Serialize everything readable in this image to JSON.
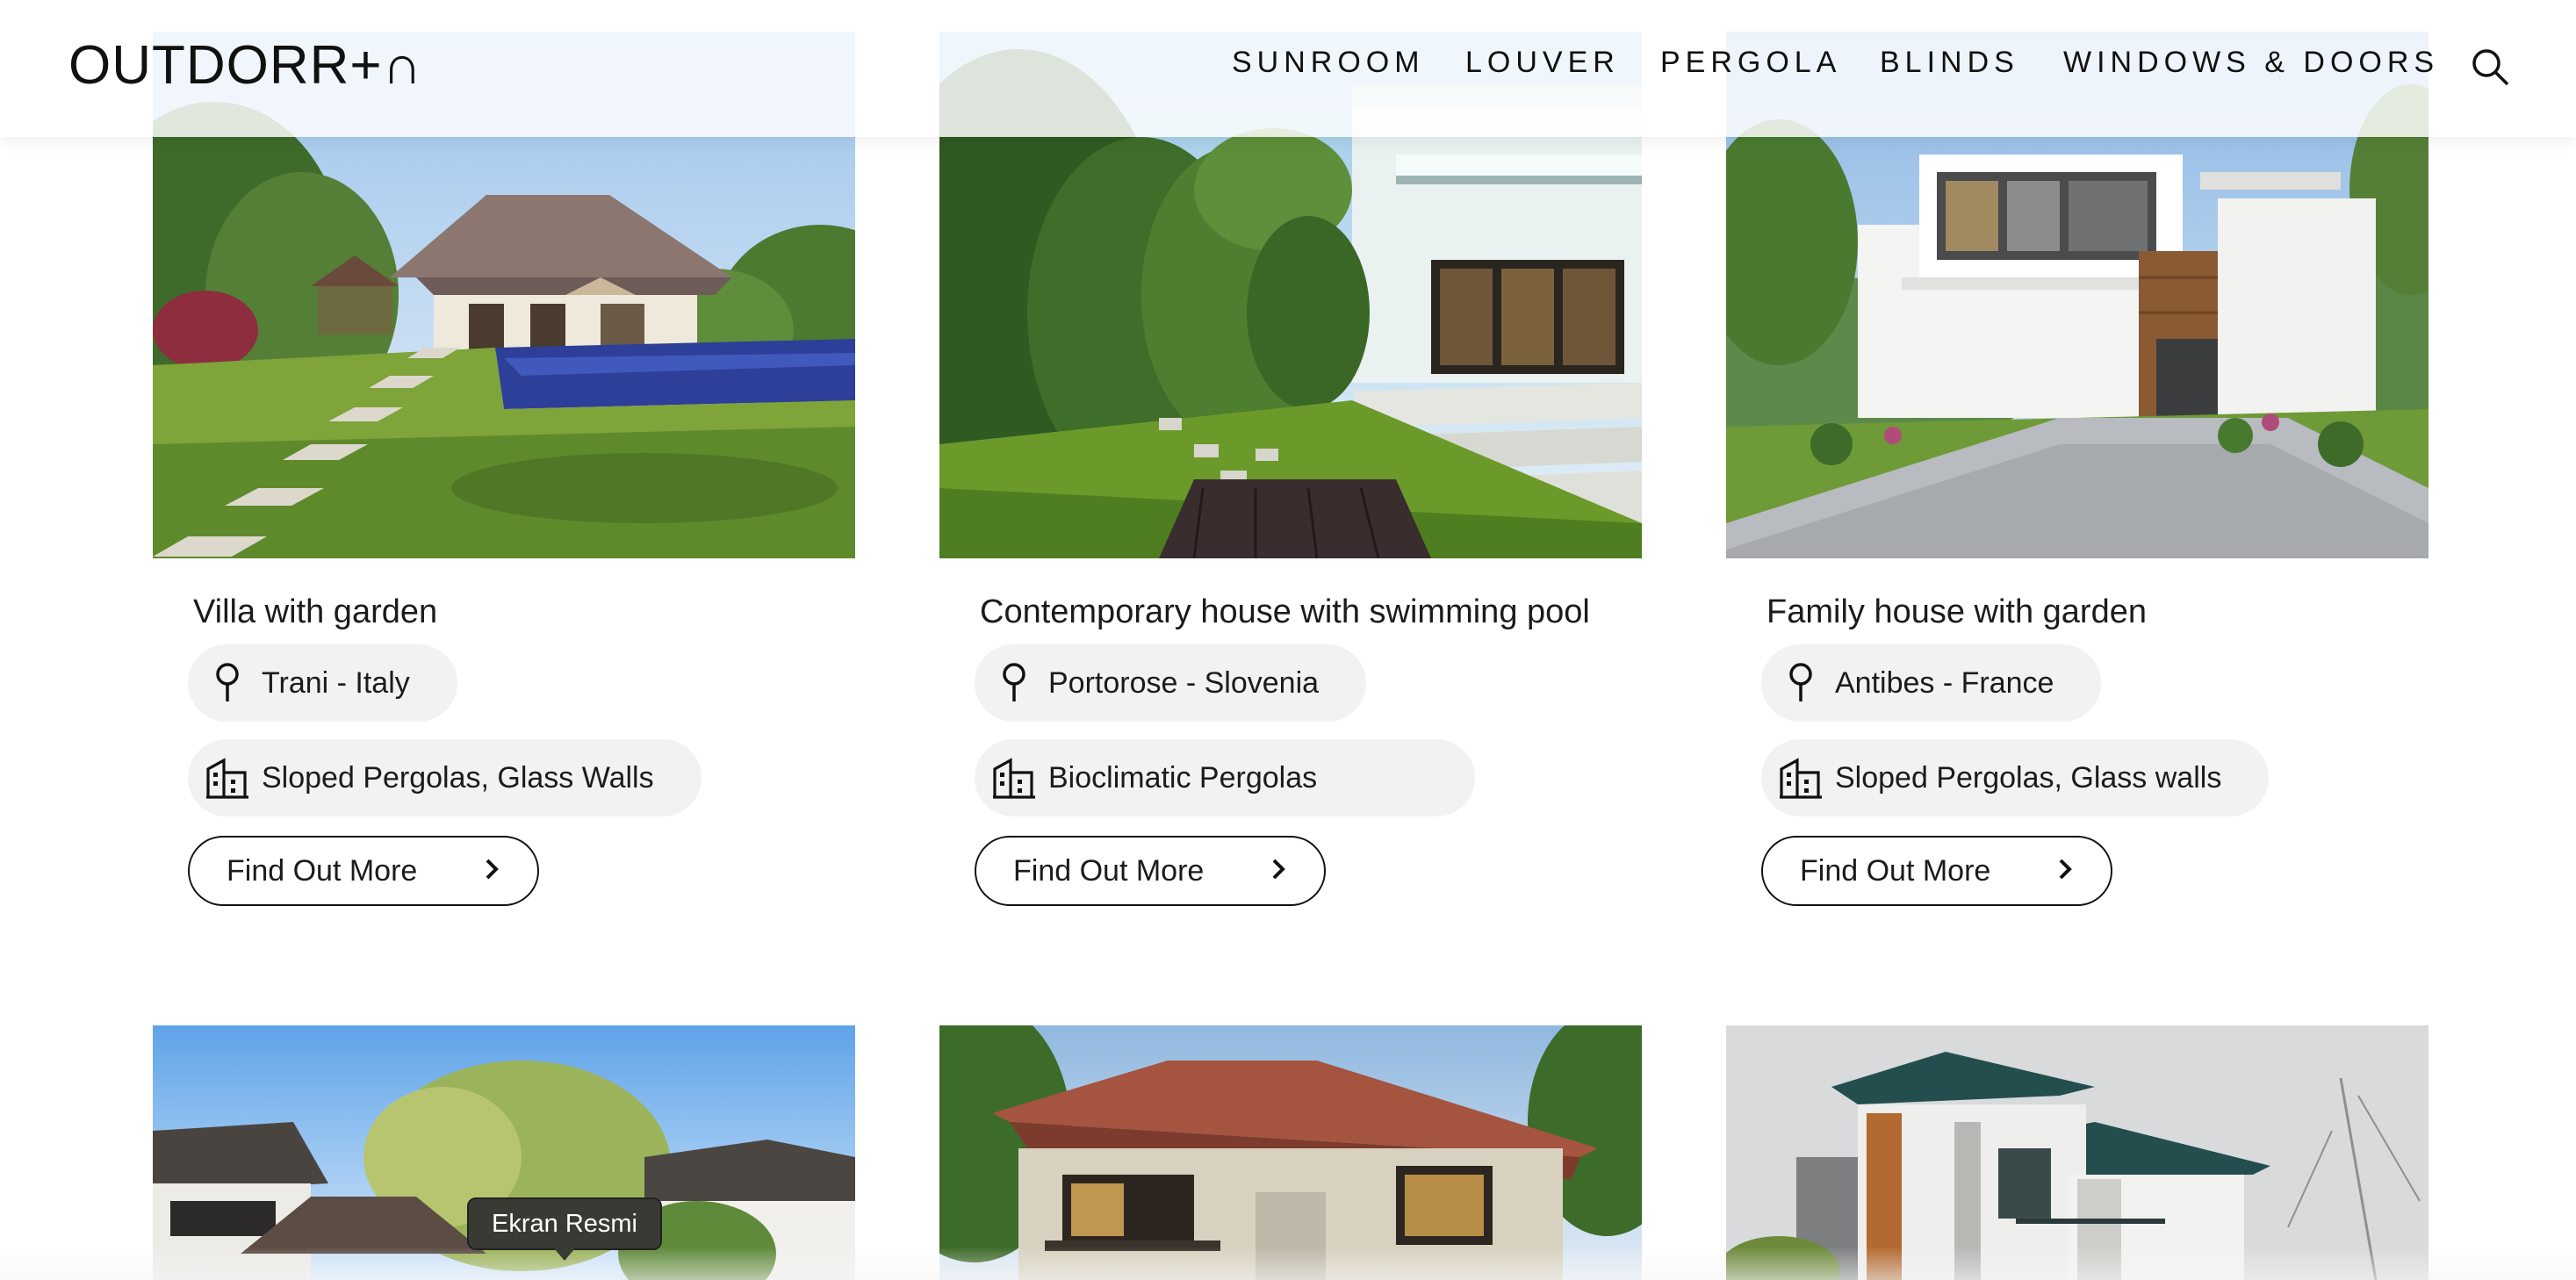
{
  "header": {
    "logo_text": "OUTDORR+∩",
    "nav": [
      {
        "label": "SUNROOM"
      },
      {
        "label": "LOUVER"
      },
      {
        "label": "PERGOLA"
      },
      {
        "label": "BLINDS"
      },
      {
        "label": "WINDOWS & DOORS"
      }
    ]
  },
  "projects": [
    {
      "title": "Villa with garden",
      "location": "Trani - Italy",
      "products": "Sloped Pergolas, Glass Walls",
      "button_label": "Find Out More",
      "image": "villa-pool-garden-photo"
    },
    {
      "title": "Contemporary house with swimming pool",
      "location": "Portorose - Slovenia",
      "products": "Bioclimatic Pergolas",
      "button_label": "Find Out More",
      "image": "modern-house-garden-photo"
    },
    {
      "title": "Family house with garden",
      "location": "Antibes - France",
      "products": "Sloped Pergolas, Glass walls",
      "button_label": "Find Out More",
      "image": "family-house-driveway-photo"
    }
  ],
  "second_row_images": [
    "tropical-house-photo",
    "tiled-roof-house-photo",
    "two-storey-house-photo"
  ],
  "tooltip": {
    "text": "Ekran Resmi"
  },
  "colors": {
    "chip_bg": "#f2f2f2",
    "text": "#111111",
    "tooltip_bg": "#3a3a35"
  }
}
